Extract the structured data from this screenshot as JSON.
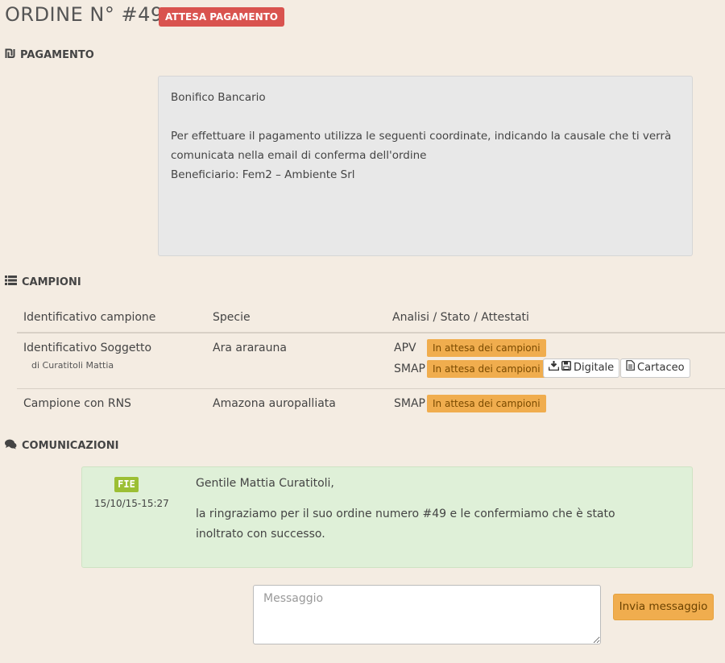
{
  "order": {
    "title": "ORDINE N° #49 –",
    "status_badge": "ATTESA PAGAMENTO",
    "status_color": "#d9534f"
  },
  "payment": {
    "section_icon": "shekel-icon",
    "section_title": "PAGAMENTO",
    "method": "Bonifico Bancario",
    "instructions": "Per effettuare il pagamento utilizza le seguenti coordinate, indicando la causale che ti verrà comunicata nella email di conferma dell'ordine",
    "beneficiary": "Beneficiario: Fem2 – Ambiente Srl"
  },
  "samples": {
    "section_icon": "list-icon",
    "section_title": "CAMPIONI",
    "columns": [
      "Identificativo campione",
      "Specie",
      "Analisi / Stato / Attestati"
    ],
    "rows": [
      {
        "id": "Identificativo Soggetto",
        "owner": "di Curatitoli Mattia",
        "species": "Ara ararauna",
        "analyses": [
          {
            "name": "APV",
            "status": "In attesa dei campioni"
          },
          {
            "name": "SMAP",
            "status": "In attesa dei campioni",
            "digital_label": "Digitale",
            "paper_label": "Cartaceo"
          }
        ]
      },
      {
        "id": "Campione con RNS",
        "species": "Amazona auropalliata",
        "analyses": [
          {
            "name": "SMAP",
            "status": "In attesa dei campioni"
          }
        ]
      }
    ],
    "status_color": "#f0ad4e"
  },
  "communications": {
    "section_icon": "comments-icon",
    "section_title": "COMUNICAZIONI",
    "messages": [
      {
        "sender_logo": "FIE",
        "datetime": "15/10/15-15:27",
        "greeting": "Gentile Mattia Curatitoli,",
        "body": "la ringraziamo per il suo ordine numero #49 e le confermiamo che è stato inoltrato con successo."
      }
    ],
    "message_placeholder": "Messaggio",
    "send_label": "Invia messaggio"
  }
}
